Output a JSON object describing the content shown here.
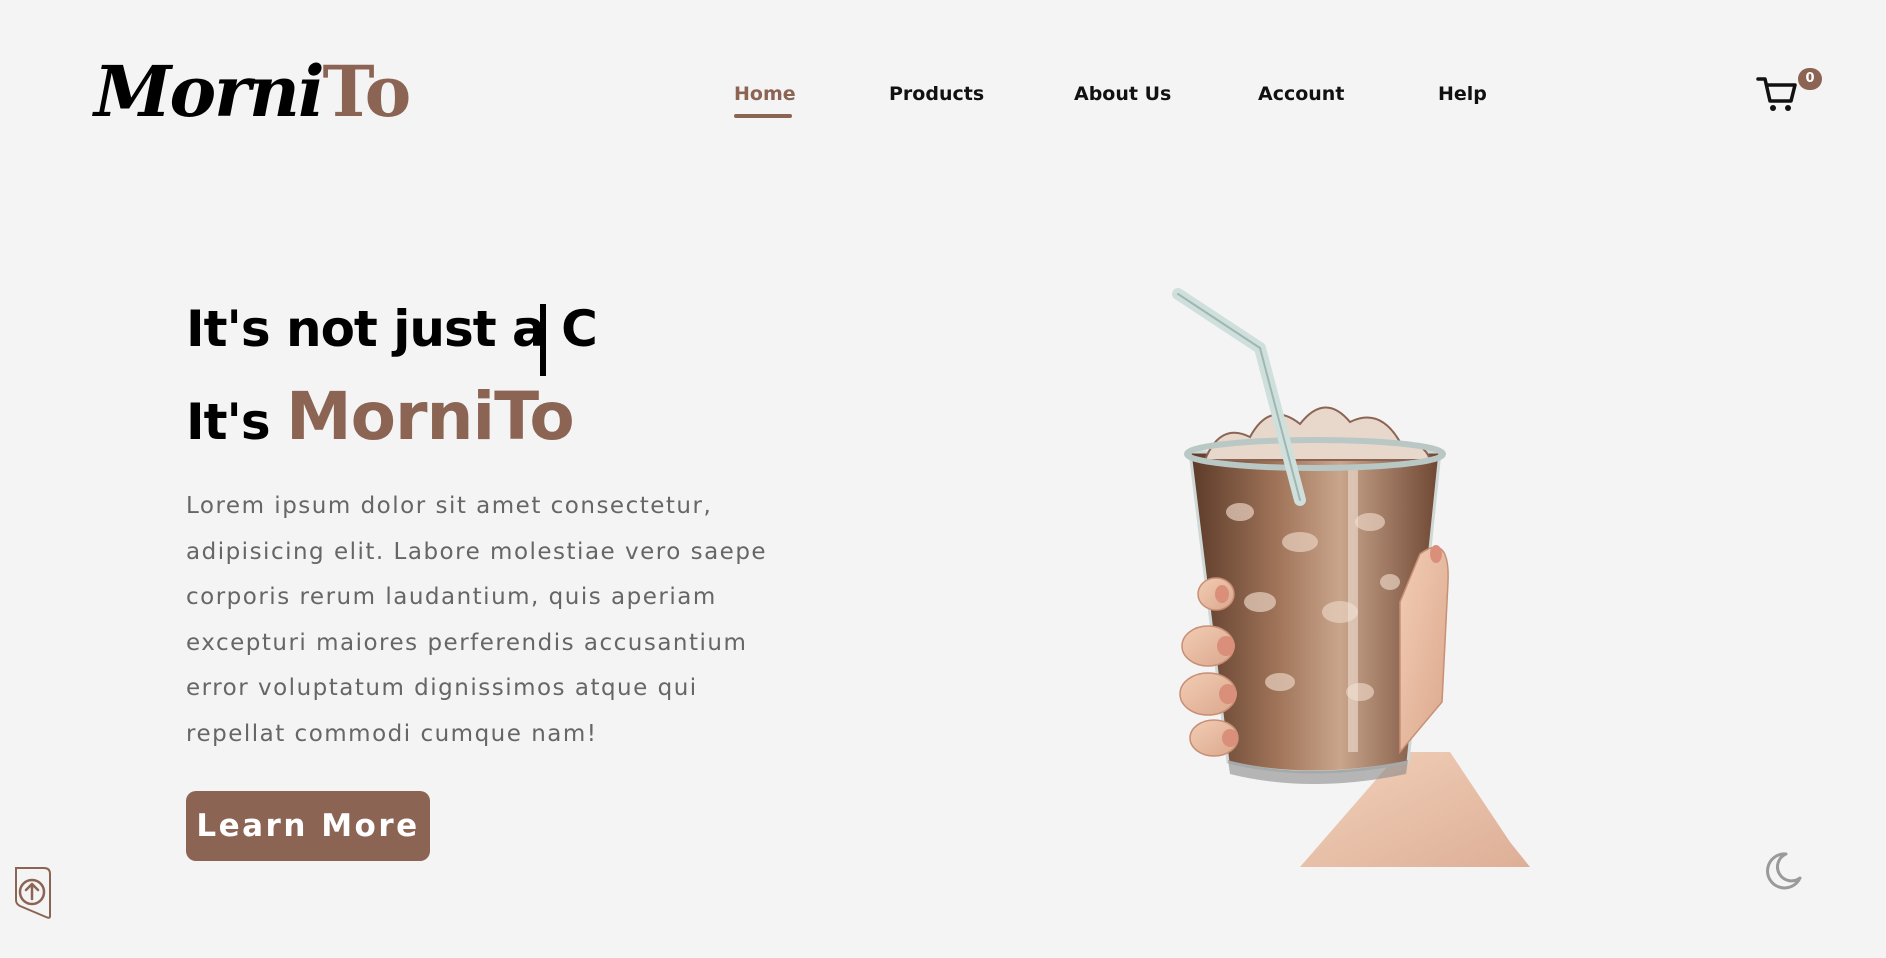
{
  "brand": {
    "part1": "Morni",
    "part2": "To",
    "accent_color": "#8c6454"
  },
  "nav": {
    "items": [
      {
        "label": "Home",
        "active": true
      },
      {
        "label": "Products",
        "active": false
      },
      {
        "label": "About Us",
        "active": false
      },
      {
        "label": "Account",
        "active": false
      },
      {
        "label": "Help",
        "active": false
      }
    ]
  },
  "cart": {
    "icon": "cart-icon",
    "count": "0"
  },
  "hero": {
    "line1": "It's not just a C",
    "line2_prefix": "It's ",
    "line2_brand": "MorniTo",
    "description": "Lorem ipsum dolor sit amet consectetur, adipisicing elit. Labore molestiae vero saepe corporis rerum laudantium, quis aperiam excepturi maiores perferendis accusantium error voluptatum dignissimos atque qui repellat commodi cumque nam!",
    "cta_label": "Learn More",
    "image": "iced-coffee-in-hand"
  },
  "icons": {
    "scroll_top": "arrow-up-icon",
    "theme": "moon-icon"
  }
}
